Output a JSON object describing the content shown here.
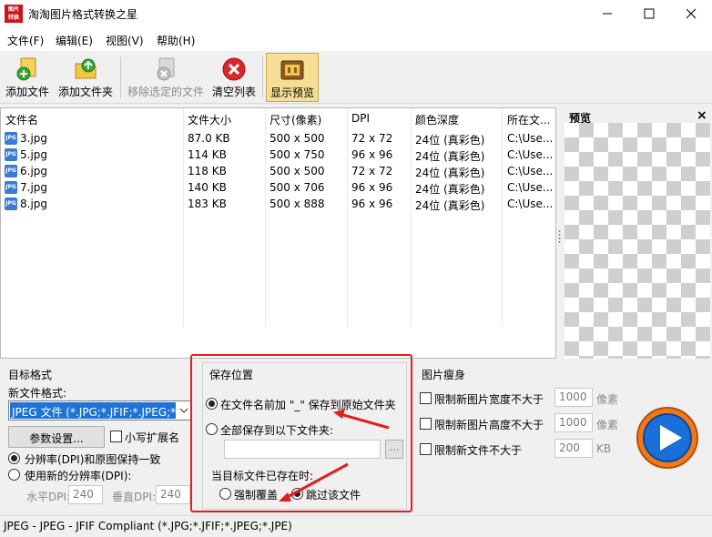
{
  "window": {
    "title": "淘淘图片格式转换之星",
    "icon_text": "图片转换"
  },
  "menu": [
    {
      "label": "文件(F)"
    },
    {
      "label": "编辑(E)"
    },
    {
      "label": "视图(V)"
    },
    {
      "label": "帮助(H)"
    }
  ],
  "toolbar": {
    "add_file": "添加文件",
    "add_folder": "添加文件夹",
    "remove_selected": "移除选定的文件",
    "clear_list": "清空列表",
    "show_preview": "显示预览"
  },
  "file_list": {
    "columns": [
      "文件名",
      "文件大小",
      "尺寸(像素)",
      "DPI",
      "颜色深度",
      "所在文..."
    ],
    "rows": [
      [
        "3.jpg",
        "87.0 KB",
        "500 x 500",
        "72 x 72",
        "24位 (真彩色)",
        "C:\\Use..."
      ],
      [
        "5.jpg",
        "114 KB",
        "500 x 750",
        "96 x 96",
        "24位 (真彩色)",
        "C:\\Use..."
      ],
      [
        "6.jpg",
        "118 KB",
        "500 x 500",
        "72 x 72",
        "24位 (真彩色)",
        "C:\\Use..."
      ],
      [
        "7.jpg",
        "140 KB",
        "500 x 706",
        "96 x 96",
        "24位 (真彩色)",
        "C:\\Use..."
      ],
      [
        "8.jpg",
        "183 KB",
        "500 x 888",
        "96 x 96",
        "24位 (真彩色)",
        "C:\\Use..."
      ]
    ],
    "file_icon_text": "JPG"
  },
  "preview": {
    "title": "预览",
    "close": "×"
  },
  "target_format": {
    "section_title": "目标格式",
    "new_format_label": "新文件格式:",
    "format_value": "JPEG 文件 (*.JPG;*.JFIF;*.JPEG;*",
    "params_button": "参数设置...",
    "lowercase_ext": "小写扩展名",
    "keep_dpi": "分辨率(DPI)和原图保持一致",
    "new_dpi": "使用新的分辨率(DPI):",
    "h_dpi_label": "水平DPI:",
    "h_dpi_value": "240",
    "v_dpi_label": "垂直DPI:",
    "v_dpi_value": "240"
  },
  "save_location": {
    "section_title": "保存位置",
    "option_prefix": "在文件名前加 \"_\" 保存到原始文件夹",
    "option_folder": "全部保存到以下文件夹:",
    "folder_value": "",
    "browse": "...",
    "exists_label": "当目标文件已存在时:",
    "overwrite": "强制覆盖",
    "skip": "跳过该文件"
  },
  "slim": {
    "section_title": "图片瘦身",
    "limit_width": "限制新图片宽度不大于",
    "width_value": "1000",
    "width_unit": "像素",
    "limit_height": "限制新图片高度不大于",
    "height_value": "1000",
    "height_unit": "像素",
    "limit_size": "限制新文件不大于",
    "size_value": "200",
    "size_unit": "KB"
  },
  "statusbar": {
    "text": "JPEG - JPEG - JFIF Compliant (*.JPG;*.JFIF;*.JPEG;*.JPE)"
  },
  "colors": {
    "accent_red": "#e02020",
    "start_blue": "#1a6fd8",
    "start_orange": "#f07a1a"
  }
}
